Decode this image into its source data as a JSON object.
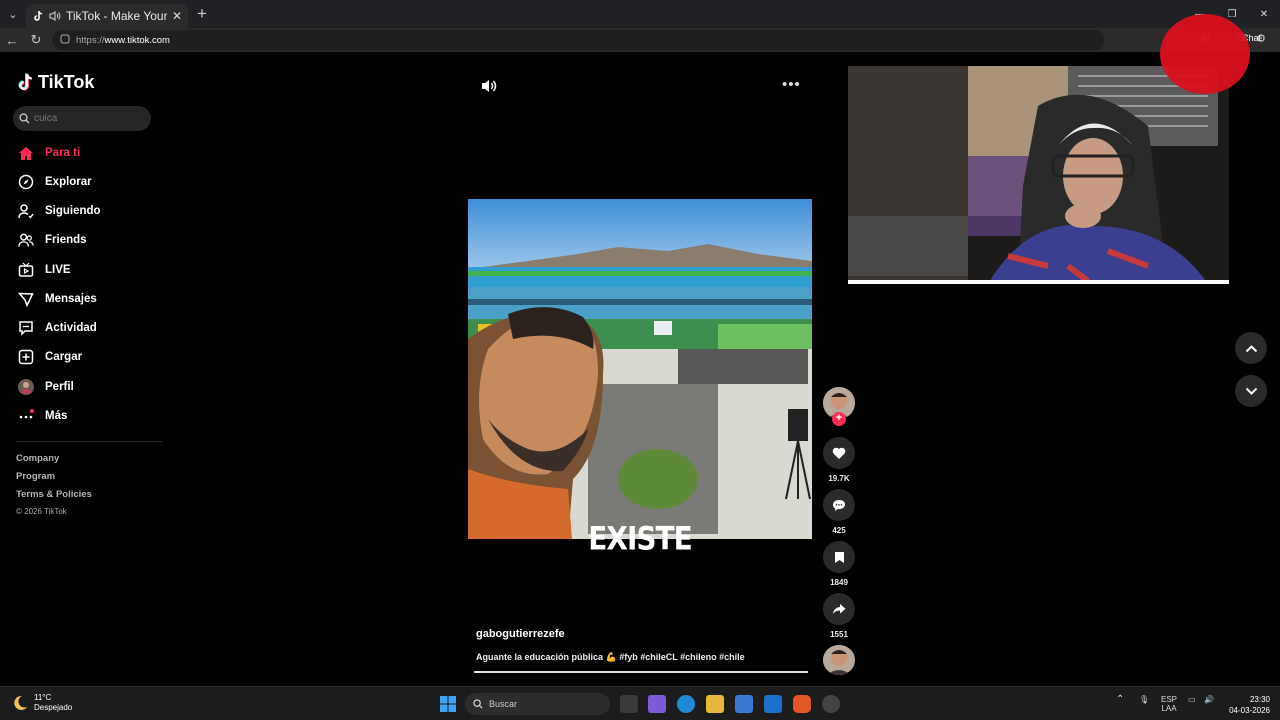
{
  "browser": {
    "tab_title": "TikTok - Make Your Day",
    "url_proto": "https://",
    "url_host": "www.tiktok.com",
    "chat_label": "Chat"
  },
  "sidebar": {
    "logo": "TikTok",
    "search_placeholder": "cuica",
    "items": [
      {
        "label": "Para ti",
        "icon": "home-icon",
        "active": true
      },
      {
        "label": "Explorar",
        "icon": "compass-icon"
      },
      {
        "label": "Siguiendo",
        "icon": "following-icon"
      },
      {
        "label": "Friends",
        "icon": "friends-icon"
      },
      {
        "label": "LIVE",
        "icon": "live-icon"
      },
      {
        "label": "Mensajes",
        "icon": "messages-icon"
      },
      {
        "label": "Actividad",
        "icon": "activity-icon"
      },
      {
        "label": "Cargar",
        "icon": "upload-icon"
      },
      {
        "label": "Perfil",
        "icon": "profile-avatar"
      },
      {
        "label": "Más",
        "icon": "more-icon"
      }
    ],
    "footer_links": [
      "Company",
      "Program",
      "Terms & Policies"
    ],
    "copyright": "© 2026 TikTok"
  },
  "video": {
    "overlay_text": "EXISTE",
    "author": "gabogutierrezefe",
    "description": "Aguante la educación pública 💪 #fyb #chileCL #chileno #chile",
    "progress": 1.0
  },
  "actions": {
    "likes": "19.7K",
    "comments": "425",
    "saves": "1849",
    "shares": "1551"
  },
  "taskbar": {
    "temperature": "11°C",
    "weather": "Despejado",
    "search_label": "Buscar",
    "lang_top": "ESP",
    "lang_bottom": "LAA",
    "time": "23:30",
    "date": "04-03-2026"
  },
  "colors": {
    "accent": "#fe2c55",
    "background": "#000000"
  }
}
